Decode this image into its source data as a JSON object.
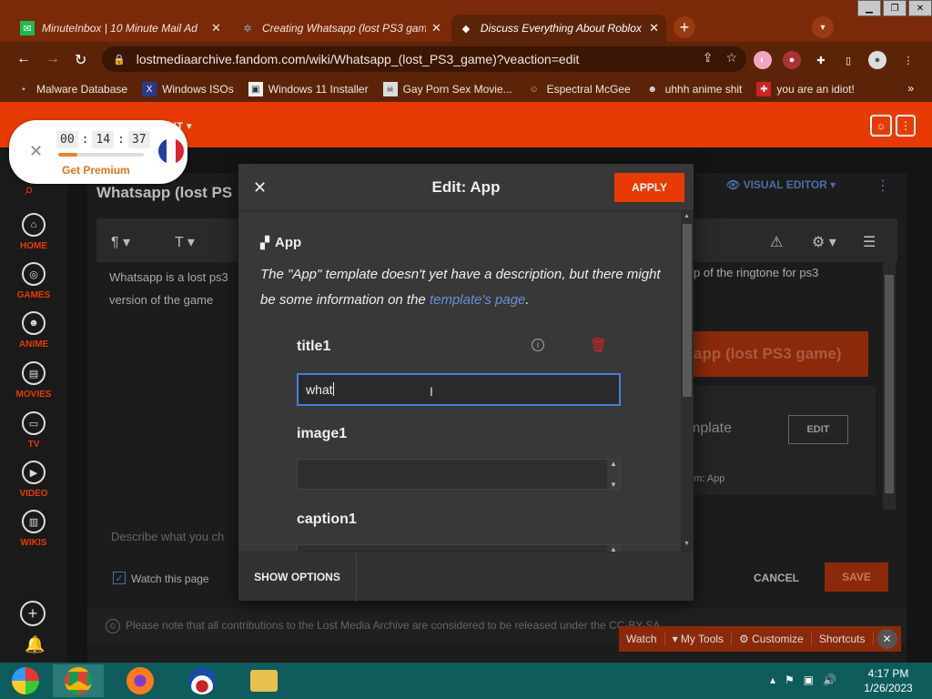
{
  "browser": {
    "tabs": [
      {
        "title": "MinuteInbox | 10 Minute Mail Ad",
        "favicon": "green-mail-icon"
      },
      {
        "title": "Creating Whatsapp (lost PS3 gam",
        "favicon": "gear-icon"
      },
      {
        "title": "Discuss Everything About Roblox",
        "favicon": "roblox-icon"
      }
    ],
    "url": "lostmediaarchive.fandom.com/wiki/Whatsapp_(lost_PS3_game)?veaction=edit",
    "bookmarks": [
      "Malware Database",
      "Windows ISOs",
      "Windows 11 Installer",
      "Gay Porn Sex Movie...",
      "Espectral McGee",
      "uhhh anime shit",
      "you are an idiot!"
    ],
    "more": "»"
  },
  "timer": {
    "h": "00",
    "m": "14",
    "s": "37",
    "progress_pct": 22,
    "premium": "Get Premium",
    "flag_colors": [
      "#1f3fa6",
      "#ffffff",
      "#e0202a"
    ]
  },
  "site": {
    "fandom_menu": "ENT ▾",
    "rail": [
      "HOME",
      "GAMES",
      "ANIME",
      "MOVIES",
      "TV",
      "VIDEO",
      "WIKIS"
    ],
    "page_title": "Whatsapp (lost PS",
    "visual_editor": "VISUAL EDITOR ▾",
    "article_text": "Whatsapp is a lost ps3 version of the game",
    "article_text_right": "p of the ringtone for ps3",
    "infobox_title": "app (lost PS3 game)",
    "tmpl_text": "mplate",
    "tmpl_from": "om: App",
    "edit_label": "EDIT",
    "summary_placeholder": "Describe what you ch",
    "watch_label": "Watch this page",
    "cancel_label": "CANCEL",
    "save_label": "SAVE",
    "notice": "Please note that all contributions to the Lost Media Archive are considered to be released under the CC-BY-SA",
    "toolbar": [
      "Watch",
      "▾ My Tools",
      "⚙ Customize",
      "Shortcuts"
    ]
  },
  "modal": {
    "title": "Edit: App",
    "apply": "APPLY",
    "template_name": "App",
    "desc_part1": "The \"App\" template doesn't yet have a description, but there might be some information on the ",
    "desc_link": "template's page",
    "desc_end": ".",
    "params": [
      {
        "label": "title1",
        "value": "what"
      },
      {
        "label": "image1",
        "value": ""
      },
      {
        "label": "caption1",
        "value": ""
      }
    ],
    "show_options": "SHOW OPTIONS"
  },
  "taskbar": {
    "time": "4:17 PM",
    "date": "1/26/2023"
  }
}
